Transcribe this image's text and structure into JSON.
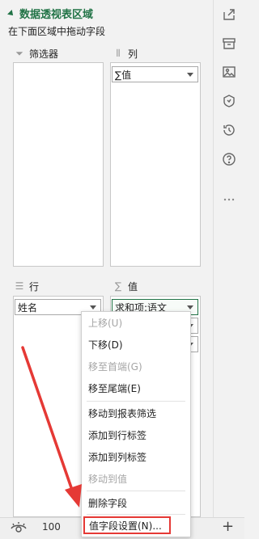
{
  "panel": {
    "title": "数据透视表区域",
    "hint": "在下面区域中拖动字段",
    "filter_label": "筛选器",
    "column_label": "列",
    "row_label": "行",
    "value_label": "值",
    "column_fields": [
      "∑值"
    ],
    "row_fields": [
      "姓名"
    ],
    "value_fields": [
      "求和项:语文"
    ]
  },
  "menu": {
    "items": [
      {
        "label": "上移(U)",
        "enabled": false
      },
      {
        "label": "下移(D)",
        "enabled": true
      },
      {
        "label": "移至首端(G)",
        "enabled": false
      },
      {
        "label": "移至尾端(E)",
        "enabled": true
      },
      {
        "label": "移动到报表筛选",
        "enabled": true
      },
      {
        "label": "添加到行标签",
        "enabled": true
      },
      {
        "label": "添加到列标签",
        "enabled": true
      },
      {
        "label": "移动到值",
        "enabled": false
      },
      {
        "label": "删除字段",
        "enabled": true
      },
      {
        "label": "值字段设置(N)...",
        "enabled": true
      }
    ]
  },
  "bottombar": {
    "zoom": "100",
    "plus": "+"
  },
  "colors": {
    "accent": "#217346",
    "highlight": "#e53935"
  },
  "toolbar_icons": [
    "share-icon",
    "archive-icon",
    "image-icon",
    "shield-icon",
    "history-icon",
    "help-icon",
    "more-icon"
  ]
}
